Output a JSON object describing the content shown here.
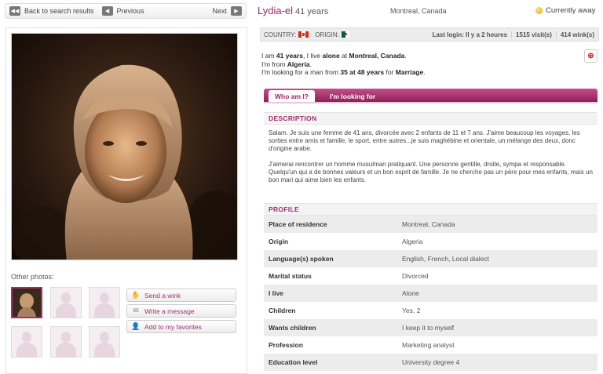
{
  "nav": {
    "back_label": "Back to search results",
    "previous_label": "Previous",
    "next_label": "Next"
  },
  "profile": {
    "name": "Lydia-el",
    "age_label": "41 years",
    "location": "Montreal, Canada",
    "status": "Currently away"
  },
  "stats": {
    "country_label": "COUNTRY:",
    "origin_label": "ORIGIN:",
    "last_login": "Last login: Il y a 2 heures",
    "visits": "1515 visit(s)",
    "winks": "414 wink(s)"
  },
  "intro": {
    "line1_pre": "I am ",
    "age": "41 years",
    "line1_mid": ", I live ",
    "live": "alone",
    "line1_at": " at ",
    "city": "Montreal, Canada",
    "line1_end": ".",
    "line2_pre": "I'm from ",
    "origin": "Algeria",
    "line2_end": ".",
    "line3_pre": "I'm looking for a man from ",
    "range": "35 at 48 years",
    "line3_mid": " for ",
    "purpose": "Marriage",
    "line3_end": "."
  },
  "tabs": {
    "who": "Who am I?",
    "looking": "I'm looking for"
  },
  "description": {
    "heading": "DESCRIPTION",
    "para1": "Salam. Je suis une femme de 41 ans, divorcée avec 2 enfants de 11 et 7 ans. J'aime beaucoup les voyages, les sorties entre amis et famille, le sport, entre autres...je suis maghébine et orientale, un mélange des deux, donc d'origine arabe.",
    "para2": "J'aimerai rencontrer un homme musulman pratiquant. Une personne gentille, droite, sympa et responsable. Quelqu'un qui a de bonnes valeurs et un bon esprit de famille. Je ne cherche pas un père pour mes enfants, mais un bon mari qui aime bien les enfants."
  },
  "profile_section": {
    "heading": "PROFILE",
    "rows": [
      {
        "label": "Place of residence",
        "value": "Montreal, Canada"
      },
      {
        "label": "Origin",
        "value": "Algeria"
      },
      {
        "label": "Language(s) spoken",
        "value": "English, French, Local dialect"
      },
      {
        "label": "Marital status",
        "value": "Divorced"
      },
      {
        "label": "I live",
        "value": "Alone"
      },
      {
        "label": "Children",
        "value": "Yes, 2"
      },
      {
        "label": "Wants children",
        "value": "I keep it to myself"
      },
      {
        "label": "Profession",
        "value": "Marketing analyst"
      },
      {
        "label": "Education level",
        "value": "University degree 4"
      }
    ]
  },
  "photos": {
    "other_label": "Other photos:"
  },
  "actions": {
    "wink": "Send a wink",
    "message": "Write a message",
    "favorite": "Add to my favorites"
  }
}
